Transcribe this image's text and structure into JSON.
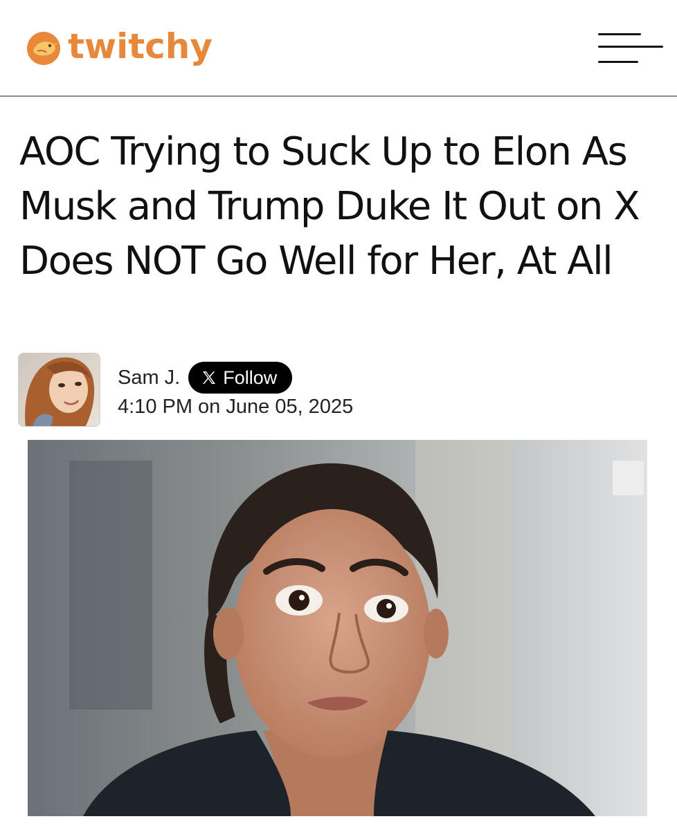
{
  "header": {
    "logo_text": "twitchy",
    "logo_icon": "bird-icon",
    "menu_icon": "hamburger-menu-icon",
    "brand_color": "#e8883a"
  },
  "article": {
    "headline": "AOC Trying to Suck Up to Elon As Musk and Trump Duke It Out on X Does NOT Go Well for Her, At All",
    "author": "Sam J.",
    "follow_label": "Follow",
    "follow_icon": "x-logo-icon",
    "timestamp": "4:10 PM on June 05, 2025"
  }
}
